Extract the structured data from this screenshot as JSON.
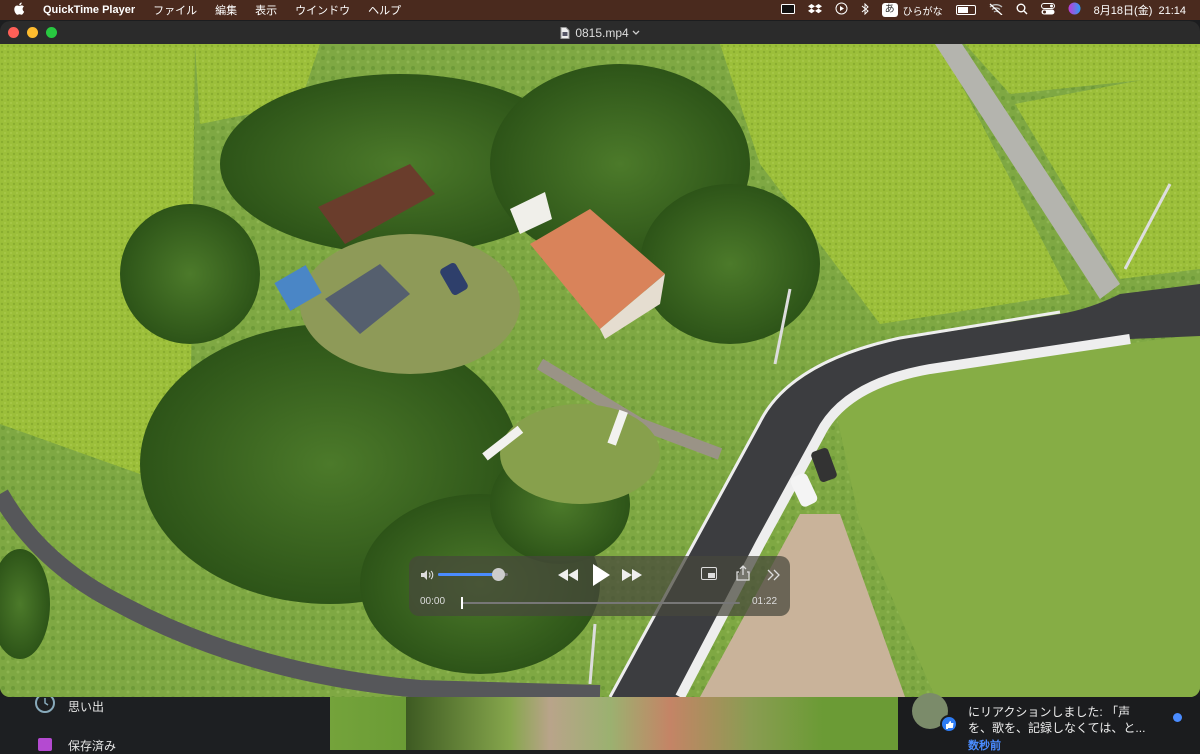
{
  "menubar": {
    "app_name": "QuickTime Player",
    "menus": [
      "ファイル",
      "編集",
      "表示",
      "ウインドウ",
      "ヘルプ"
    ],
    "ime_badge": "あ",
    "ime_label": "ひらがな",
    "datetime": "8月18日(金)  21:14"
  },
  "window": {
    "title": "0815.mp4"
  },
  "player": {
    "current_time": "00:00",
    "duration": "01:22",
    "volume_level": 0.85,
    "progress": 0.0
  },
  "dock_area": {
    "sidebar_items": [
      {
        "label": "思い出",
        "icon": "memories-icon"
      },
      {
        "label": "保存済み",
        "icon": "saved-icon"
      }
    ],
    "notification": {
      "line1": "にリアクションしました: 「声",
      "line2": "を、歌を、記録しなくては、と...",
      "time": "数秒前"
    }
  },
  "colors": {
    "menubar_bg": "#4a2a1e",
    "slider_fill": "#4a8cff",
    "notif_time": "#4a8cff"
  }
}
